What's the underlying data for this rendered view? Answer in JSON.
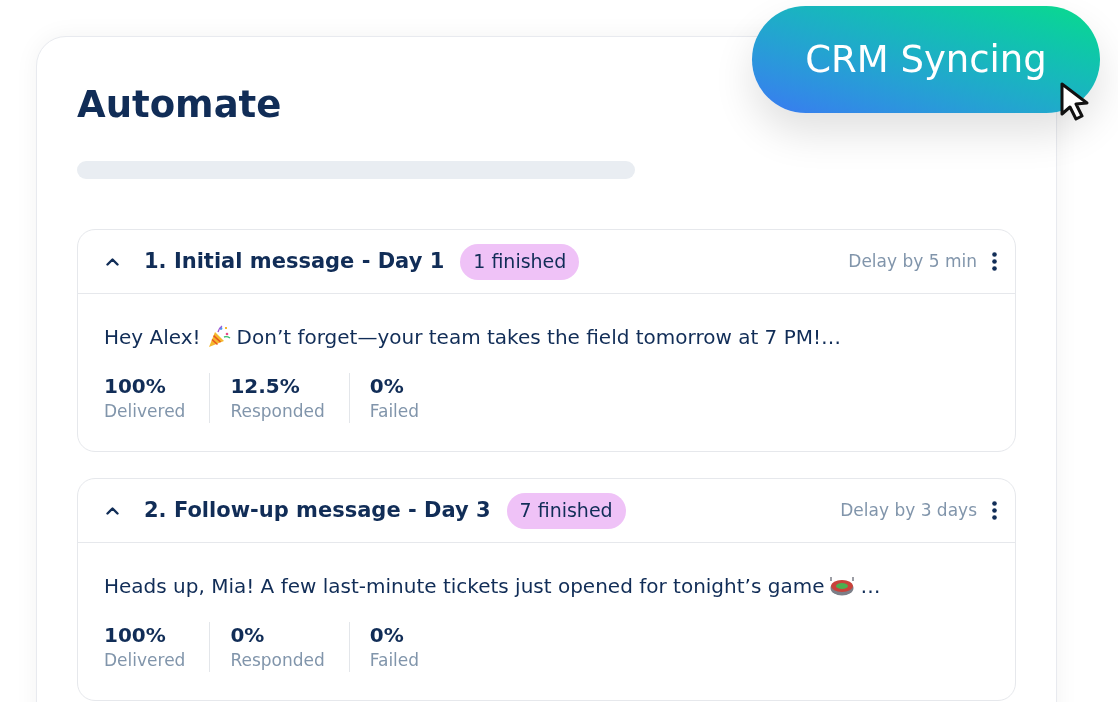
{
  "page": {
    "title": "Automate"
  },
  "sync_button": {
    "label": "CRM Syncing"
  },
  "steps": [
    {
      "title": "1. Initial message - Day 1",
      "expanded": true,
      "badge": "1 finished",
      "delay": "Delay by 5 min",
      "message": [
        {
          "kind": "text",
          "text": "Hey Alex!"
        },
        {
          "kind": "popper"
        },
        {
          "kind": "text",
          "text": "Don’t forget—your team takes the field tomorrow at 7 PM!…"
        }
      ],
      "stats": [
        {
          "value": "100%",
          "label": "Delivered"
        },
        {
          "value": "12.5%",
          "label": "Responded"
        },
        {
          "value": "0%",
          "label": "Failed"
        }
      ]
    },
    {
      "title": "2. Follow-up message - Day 3",
      "expanded": true,
      "badge": "7 finished",
      "delay": "Delay by 3 days",
      "message": [
        {
          "kind": "text",
          "text": "Heads up, Mia! A few last-minute tickets just opened for tonight’s game"
        },
        {
          "kind": "stadium"
        },
        {
          "kind": "text",
          "text": "…"
        }
      ],
      "stats": [
        {
          "value": "100%",
          "label": "Delivered"
        },
        {
          "value": "0%",
          "label": "Responded"
        },
        {
          "value": "0%",
          "label": "Failed"
        }
      ]
    }
  ]
}
